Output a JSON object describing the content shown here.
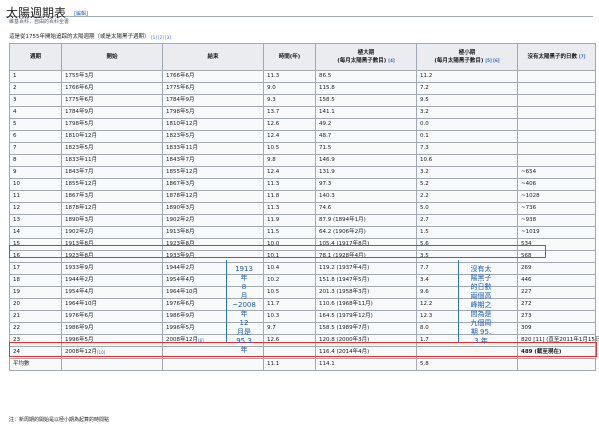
{
  "page": {
    "title": "太陽週期表",
    "edit_label": "[編輯]",
    "subtitle": "維基百科，自由的百科全書",
    "caption": "這是從1755年開始追踪的太陽週期（或是太陽黑子週期）",
    "caption_refs": "[1] [2] [3]",
    "footnote": "注：新周期的開始是以極小期為起算的時間點"
  },
  "table": {
    "headers": {
      "cycle": "週期",
      "start": "開始",
      "end": "結束",
      "duration": "時間(年)",
      "max": "極大期",
      "max_sub": "(每月太陽黑子數目)",
      "max_ref": "[4]",
      "min": "極小期",
      "min_sub": "(每月太陽黑子數目)",
      "min_ref": "[5] [6]",
      "spotless": "沒有太陽黑子的日數",
      "spotless_ref": "[7]"
    },
    "rows": [
      {
        "cycle": "1",
        "start": "1755年3月",
        "end": "1766年6月",
        "dur": "11.3",
        "max": "86.5",
        "min": "11.2",
        "spotless": ""
      },
      {
        "cycle": "2",
        "start": "1766年6月",
        "end": "1775年6月",
        "dur": "9.0",
        "max": "115.8",
        "min": "7.2",
        "spotless": ""
      },
      {
        "cycle": "3",
        "start": "1775年6月",
        "end": "1784年9月",
        "dur": "9.3",
        "max": "158.5",
        "min": "9.5",
        "spotless": ""
      },
      {
        "cycle": "4",
        "start": "1784年9月",
        "end": "1798年5月",
        "dur": "13.7",
        "max": "141.1",
        "min": "3.2",
        "spotless": ""
      },
      {
        "cycle": "5",
        "start": "1798年5月",
        "end": "1810年12月",
        "dur": "12.6",
        "max": "49.2",
        "min": "0.0",
        "spotless": ""
      },
      {
        "cycle": "6",
        "start": "1810年12月",
        "end": "1823年5月",
        "dur": "12.4",
        "max": "48.7",
        "min": "0.1",
        "spotless": ""
      },
      {
        "cycle": "7",
        "start": "1823年5月",
        "end": "1833年11月",
        "dur": "10.5",
        "max": "71.5",
        "min": "7.3",
        "spotless": ""
      },
      {
        "cycle": "8",
        "start": "1833年11月",
        "end": "1843年7月",
        "dur": "9.8",
        "max": "146.9",
        "min": "10.6",
        "spotless": ""
      },
      {
        "cycle": "9",
        "start": "1843年7月",
        "end": "1855年12月",
        "dur": "12.4",
        "max": "131.9",
        "min": "3.2",
        "spotless": "~654"
      },
      {
        "cycle": "10",
        "start": "1855年12月",
        "end": "1867年3月",
        "dur": "11.3",
        "max": "97.3",
        "min": "5.2",
        "spotless": "~406"
      },
      {
        "cycle": "11",
        "start": "1867年3月",
        "end": "1878年12月",
        "dur": "11.8",
        "max": "140.3",
        "min": "2.2",
        "spotless": "~1028"
      },
      {
        "cycle": "12",
        "start": "1878年12月",
        "end": "1890年3月",
        "dur": "11.3",
        "max": "74.6",
        "min": "5.0",
        "spotless": "~736"
      },
      {
        "cycle": "13",
        "start": "1890年3月",
        "end": "1902年2月",
        "dur": "11.9",
        "max": "87.9 (1894年1月)",
        "min": "2.7",
        "spotless": "~938"
      },
      {
        "cycle": "14",
        "start": "1902年2月",
        "end": "1913年8月",
        "dur": "11.5",
        "max": "64.2 (1906年2月)",
        "min": "1.5",
        "spotless": "~1019"
      },
      {
        "cycle": "15",
        "start": "1913年8月",
        "end": "1923年8月",
        "dur": "10.0",
        "max": "105.4 (1917年8月)",
        "min": "5.6",
        "spotless": "534"
      },
      {
        "cycle": "16",
        "start": "1923年8月",
        "end": "1933年9月",
        "dur": "10.1",
        "max": "78.1 (1928年4月)",
        "min": "3.5",
        "spotless": "568"
      },
      {
        "cycle": "17",
        "start": "1933年9月",
        "end": "1944年2月",
        "dur": "10.4",
        "max": "119.2 (1937年4月)",
        "min": "7.7",
        "spotless": "269"
      },
      {
        "cycle": "18",
        "start": "1944年2月",
        "end": "1954年4月",
        "dur": "10.2",
        "max": "151.8 (1947年5月)",
        "min": "3.4",
        "spotless": "446"
      },
      {
        "cycle": "19",
        "start": "1954年4月",
        "end": "1964年10月",
        "dur": "10.5",
        "max": "201.3 (1958年3月)",
        "min": "9.6",
        "spotless": "227"
      },
      {
        "cycle": "20",
        "start": "1964年10月",
        "end": "1976年6月",
        "dur": "11.7",
        "max": "110.6 (1968年11月)",
        "min": "12.2",
        "spotless": "272"
      },
      {
        "cycle": "21",
        "start": "1976年6月",
        "end": "1986年9月",
        "dur": "10.3",
        "max": "164.5 (1979年12月)",
        "min": "12.3",
        "spotless": "273"
      },
      {
        "cycle": "22",
        "start": "1986年9月",
        "end": "1996年5月",
        "dur": "9.7",
        "max": "158.5 (1989年7月)",
        "min": "8.0",
        "spotless": "309"
      },
      {
        "cycle": "23",
        "start": "1996年5月",
        "end": "2008年12月",
        "end_ref": "[8]",
        "dur": "12.6",
        "max": "120.8 (2000年3月)",
        "min": "1.7",
        "spotless": "820",
        "spotless_extra": " [11] (直至2011年1月15日)"
      },
      {
        "cycle": "24",
        "start": "2008年12月",
        "start_ref": "[10]",
        "end": "",
        "dur": "",
        "max": "116.4 (2014年4月)",
        "min": "",
        "spotless": "489 (截至現在)",
        "bold_spotless": true
      }
    ],
    "avg": {
      "label": "平均數",
      "dur": "11.1",
      "max": "114.1",
      "min": "5.8",
      "spotless": ""
    }
  },
  "annotations": {
    "left_note": "1913\n年\n8\n月\n~2008\n年\n12\n月是\n95.3\n年",
    "right_note": "沒有太\n陽黑子\n的日數\n兩個高\n峰期之\n間為是\n九個周\n期 95.\n3 年"
  },
  "colors": {
    "accent": "#d33333",
    "annotation": "#1a5fb4",
    "link": "#3366cc"
  }
}
